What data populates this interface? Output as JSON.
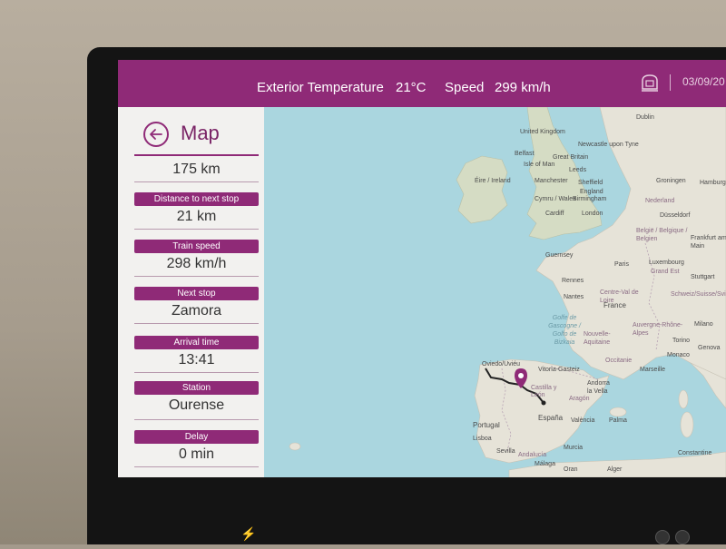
{
  "status_bar": {
    "temperature_label": "Exterior Temperature",
    "temperature_value": "21°C",
    "speed_label": "Speed",
    "speed_value": "299 km/h",
    "date": "03/09/20"
  },
  "panel": {
    "title": "Map",
    "first_value": "175 km",
    "stats": [
      {
        "label": "Distance to next stop",
        "value": "21 km"
      },
      {
        "label": "Train speed",
        "value": "298 km/h"
      },
      {
        "label": "Next stop",
        "value": "Zamora"
      },
      {
        "label": "Arrival time",
        "value": "13:41"
      },
      {
        "label": "Station",
        "value": "Ourense"
      },
      {
        "label": "Delay",
        "value": "0 min"
      }
    ]
  },
  "map": {
    "cities": [
      "Dublin",
      "United Kingdom",
      "Newcastle upon Tyne",
      "Belfast",
      "Great Britain",
      "Isle of Man",
      "Leeds",
      "Éire / Ireland",
      "Manchester",
      "Sheffield",
      "England",
      "Cymru / Wales",
      "Birmingham",
      "Cardiff",
      "London",
      "Groningen",
      "Hamburg",
      "Nederland",
      "Düsseldorf",
      "België / Belgique / Belgien",
      "Frankfurt am Main",
      "Guernsey",
      "Paris",
      "Luxembourg",
      "Grand Est",
      "Stuttgart",
      "Rennes",
      "Nantes",
      "Centre-Val de Loire",
      "France",
      "Schweiz/Suisse/Svizzera",
      "Golfe de Gascogne / Golfo de Bizkaia",
      "Nouvelle-Aquitaine",
      "Auvergne-Rhône-Alpes",
      "Milano",
      "Torino",
      "Genova",
      "Monaco",
      "Marseille",
      "Occitanie",
      "Oviedo/Uviéu",
      "Vitoria-Gasteiz",
      "Castilla y León",
      "Andorra la Vella",
      "Aragón",
      "Portugal",
      "España",
      "València",
      "Palma",
      "Lisboa",
      "Sevilla",
      "Andalucía",
      "Murcia",
      "Málaga",
      "Oran",
      "Alger",
      "Constantine"
    ],
    "pin_icon": "location-pin-icon",
    "route_color": "#222222",
    "pin_color": "#8f2a77"
  },
  "colors": {
    "accent": "#8f2a77",
    "sea": "#aad6df",
    "land": "#e6e3d8"
  }
}
